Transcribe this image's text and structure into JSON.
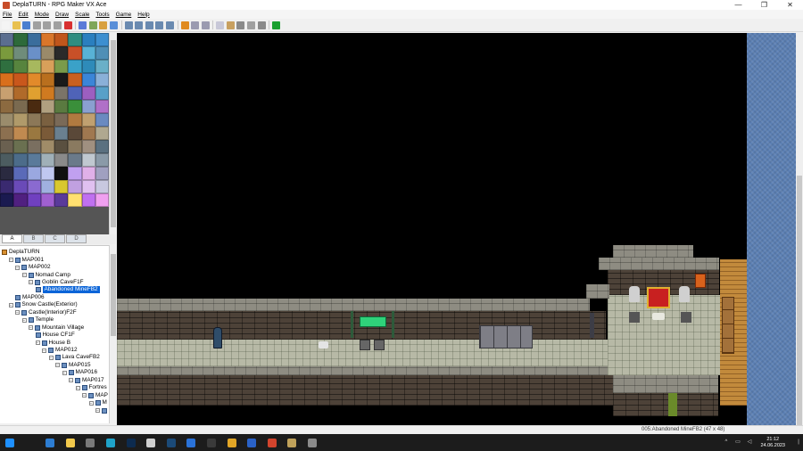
{
  "window": {
    "title": "DeplaTURN - RPG Maker VX Ace",
    "minimize": "—",
    "maximize": "❐",
    "close": "✕"
  },
  "menu": [
    "File",
    "Edit",
    "Mode",
    "Draw",
    "Scale",
    "Tools",
    "Game",
    "Help"
  ],
  "toolbar": {
    "icons": [
      "new-project-icon",
      "open-project-icon",
      "save-icon",
      "cut-icon",
      "copy-icon",
      "paste-icon",
      "delete-icon",
      "undo-icon",
      "layer1-icon",
      "layer2-icon",
      "event-layer-icon",
      "pencil-icon",
      "rectangle-icon",
      "ellipse-icon",
      "fill-icon",
      "shadow-pen-icon",
      "scale-1-1-icon",
      "scale-1-2-icon",
      "scale-1-4-icon",
      "database-icon",
      "resource-manager-icon",
      "script-editor-icon",
      "sound-test-icon",
      "character-generator-icon",
      "playtest-icon"
    ]
  },
  "tileset": {
    "tabs": [
      "A",
      "B",
      "C",
      "D"
    ],
    "active_tab": "A",
    "tile_colors": [
      "#5b6e8f",
      "#2d6a3a",
      "#3a6d9c",
      "#d9762a",
      "#c0561c",
      "#2f8d80",
      "#2a7fbf",
      "#3d8fd0",
      "#7a9a3d",
      "#6f8c7a",
      "#6a90c8",
      "#9a8a6a",
      "#2a2a2a",
      "#c85028",
      "#58b2d6",
      "#4f8fb6",
      "#2f6f3f",
      "#57843e",
      "#a7b85e",
      "#d9a05a",
      "#7a9b4a",
      "#3aa1c8",
      "#2e8bb9",
      "#6ab0c8",
      "#d96f1c",
      "#c9571c",
      "#e28a2a",
      "#b96f1e",
      "#1a1a1a",
      "#c86020",
      "#3b85d8",
      "#8ab0d8",
      "#c8a070",
      "#b06a2a",
      "#e0a030",
      "#d07a20",
      "#7b7468",
      "#4f63b8",
      "#9c5fc0",
      "#58a0c8",
      "#8c6a40",
      "#7a6a50",
      "#4a2a10",
      "#b0a080",
      "#5a7a40",
      "#3a8f3a",
      "#8aa0d0",
      "#b070c8",
      "#9a8c6c",
      "#b09a6a",
      "#8c7858",
      "#7a6040",
      "#7a6a58",
      "#b07a40",
      "#c0a070",
      "#6a8ac0",
      "#8c7050",
      "#c08a50",
      "#9a7840",
      "#7a5a38",
      "#6a8090",
      "#5a4838",
      "#a07850",
      "#b0a890",
      "#6a6050",
      "#6a7050",
      "#7a6f60",
      "#a08c68",
      "#5a5040",
      "#8a7a60",
      "#a09080",
      "#5a7080",
      "#4c5c60",
      "#4c6c8a",
      "#5a7a9a",
      "#a0b0b8",
      "#8a8a8a",
      "#6a7a8a",
      "#c0c8d0",
      "#8a9aa8",
      "#2a2a40",
      "#5a6ab8",
      "#9aa8e0",
      "#c0c8f0",
      "#101010",
      "#c0a0f0",
      "#e0b0e8",
      "#a0a0c0",
      "#3a2a70",
      "#6a4ab8",
      "#8a6ad0",
      "#a0b0e0",
      "#d8c830",
      "#c0a0e0",
      "#e0c0f0",
      "#c8c8e0",
      "#1a1a50",
      "#502080",
      "#7040c0",
      "#a060d0",
      "#5a3a9a",
      "#ffe070",
      "#c070f0",
      "#f0a0f0"
    ]
  },
  "map_tree": {
    "items": [
      {
        "label": "DeplaTURN",
        "depth": 0,
        "expander": "",
        "selected": false
      },
      {
        "label": "MAP001",
        "depth": 1,
        "expander": "−",
        "selected": false
      },
      {
        "label": "MAP002",
        "depth": 2,
        "expander": "−",
        "selected": false
      },
      {
        "label": "Nomad Camp",
        "depth": 3,
        "expander": "−",
        "selected": false
      },
      {
        "label": "Goblin CaveF1F",
        "depth": 4,
        "expander": "−",
        "selected": false
      },
      {
        "label": "Abandoned MineFB2",
        "depth": 5,
        "expander": "",
        "selected": true
      },
      {
        "label": "MAP006",
        "depth": 2,
        "expander": "",
        "selected": false
      },
      {
        "label": "Snow Castle(Exterior)",
        "depth": 1,
        "expander": "−",
        "selected": false
      },
      {
        "label": "Castle(Interior)F2F",
        "depth": 2,
        "expander": "−",
        "selected": false
      },
      {
        "label": "Temple",
        "depth": 3,
        "expander": "−",
        "selected": false
      },
      {
        "label": "Mountain Village",
        "depth": 4,
        "expander": "−",
        "selected": false
      },
      {
        "label": "House CF1F",
        "depth": 5,
        "expander": "",
        "selected": false
      },
      {
        "label": "House B",
        "depth": 5,
        "expander": "−",
        "selected": false
      },
      {
        "label": "MAP012",
        "depth": 6,
        "expander": "−",
        "selected": false
      },
      {
        "label": "Lava CaveFB2",
        "depth": 7,
        "expander": "−",
        "selected": false
      },
      {
        "label": "MAP015",
        "depth": 8,
        "expander": "−",
        "selected": false
      },
      {
        "label": "MAP016",
        "depth": 9,
        "expander": "−",
        "selected": false
      },
      {
        "label": "MAP017",
        "depth": 10,
        "expander": "−",
        "selected": false
      },
      {
        "label": "Fortres",
        "depth": 11,
        "expander": "−",
        "selected": false
      },
      {
        "label": "MAP",
        "depth": 12,
        "expander": "−",
        "selected": false
      },
      {
        "label": "M",
        "depth": 13,
        "expander": "−",
        "selected": false
      },
      {
        "label": "",
        "depth": 14,
        "expander": "−",
        "selected": false
      }
    ]
  },
  "statusbar": {
    "text": "005:Abandoned MineFB2 (47 x 48)"
  },
  "taskbar": {
    "apps": [
      {
        "name": "start-icon",
        "color": "#1e90ff"
      },
      {
        "name": "search-icon",
        "color": "#1c1c1c"
      },
      {
        "name": "editor-icon",
        "color": "#2d7dd2"
      },
      {
        "name": "file-explorer-icon",
        "color": "#f2c94c"
      },
      {
        "name": "settings-icon",
        "color": "#7a7a7a"
      },
      {
        "name": "edge-icon",
        "color": "#1fa3c9"
      },
      {
        "name": "photoshop-icon",
        "color": "#0d2b4f"
      },
      {
        "name": "roblox-icon",
        "color": "#cfcfcf"
      },
      {
        "name": "steam-icon",
        "color": "#1b4a78"
      },
      {
        "name": "ccleaner-icon",
        "color": "#2a72d8"
      },
      {
        "name": "epic-games-icon",
        "color": "#3a3a3a"
      },
      {
        "name": "chrome-icon",
        "color": "#e2a626"
      },
      {
        "name": "vpn-icon",
        "color": "#2a62c8"
      },
      {
        "name": "browser-icon",
        "color": "#d2442d"
      },
      {
        "name": "rpg-maker-icon",
        "color": "#bfa15a"
      },
      {
        "name": "app-window-icon",
        "color": "#8a8a8a"
      }
    ],
    "time": "21:12",
    "date": "24.06.2023"
  }
}
